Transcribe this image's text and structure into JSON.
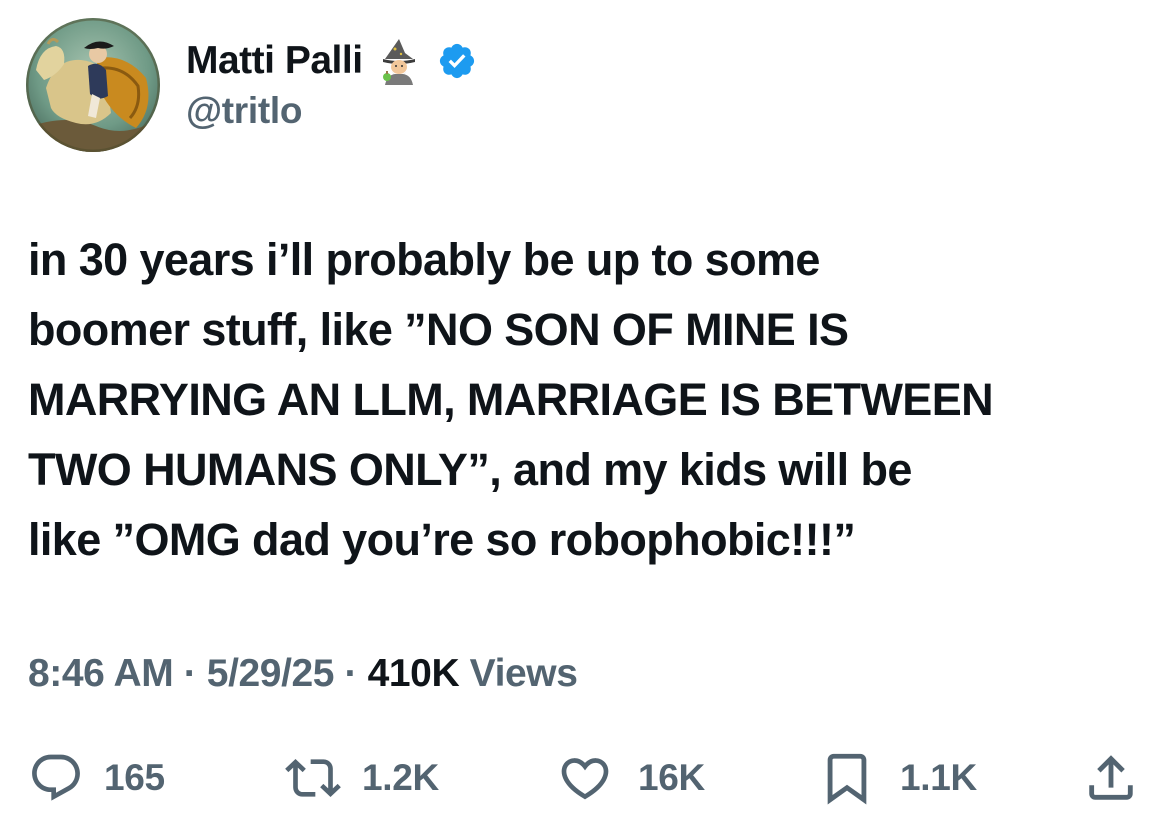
{
  "author": {
    "display_name": "Matti Palli",
    "name_emoji": "mage-emoji",
    "verified_icon": "verified-badge-icon",
    "handle": "@tritlo"
  },
  "tweet": {
    "text": "in 30 years i’ll probably be up to some\nboomer stuff, like ”NO SON OF MINE IS\nMARRYING AN LLM, MARRIAGE IS BETWEEN\nTWO HUMANS ONLY”, and my kids will be\nlike ”OMG dad you’re so robophobic!!!”"
  },
  "meta": {
    "time": "8:46 AM",
    "separator": "·",
    "date": "5/29/25",
    "views_count": "410K",
    "views_label": "Views"
  },
  "actions": {
    "replies": "165",
    "reposts": "1.2K",
    "likes": "16K",
    "bookmarks": "1.1K"
  },
  "colors": {
    "text_primary": "#0f1419",
    "text_secondary": "#536471",
    "verified_blue": "#1d9bf0"
  }
}
